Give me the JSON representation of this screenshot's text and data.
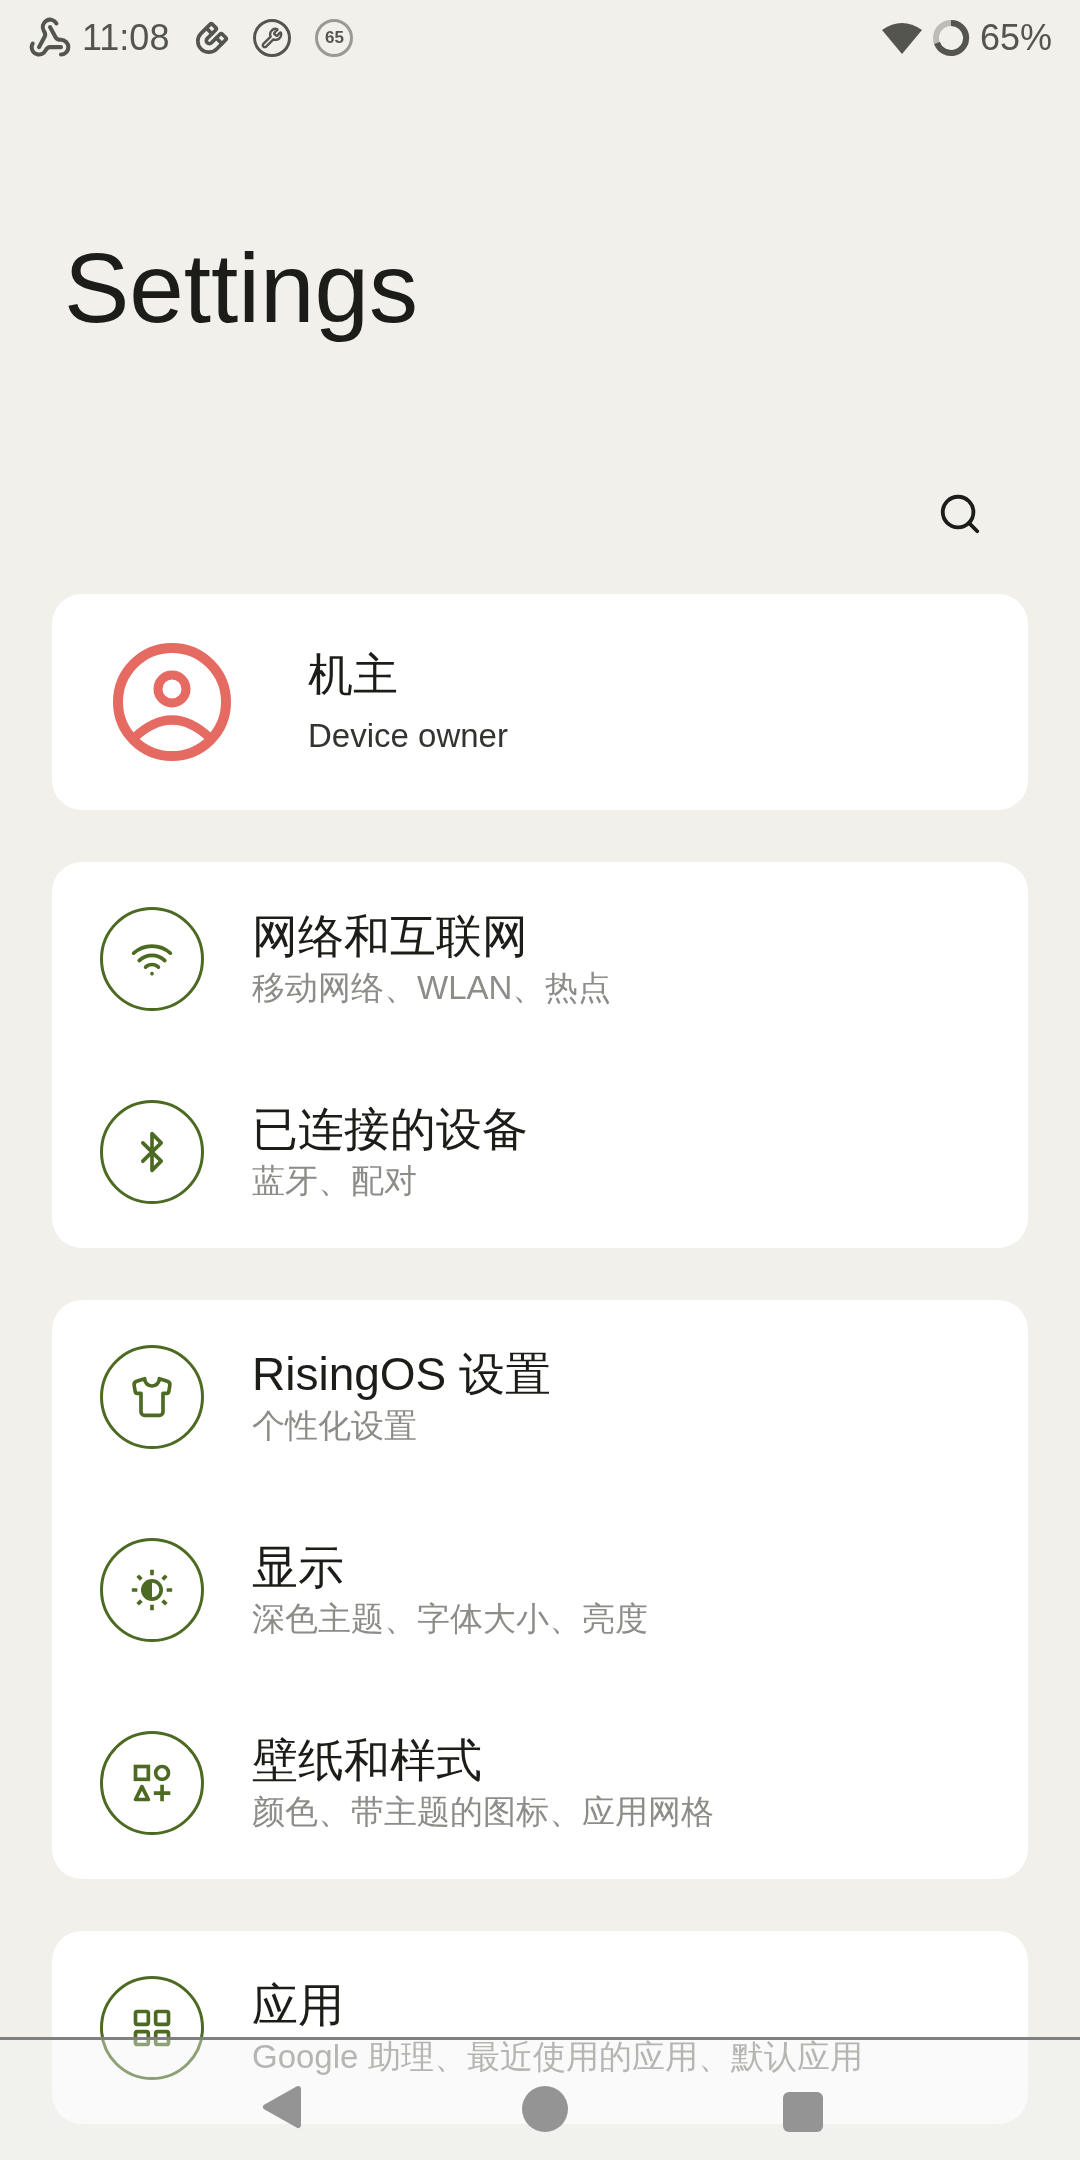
{
  "status_bar": {
    "time": "11:08",
    "badge_number": "65",
    "battery": "65%"
  },
  "title": "Settings",
  "owner": {
    "name": "机主",
    "subtitle": "Device owner"
  },
  "groups": [
    {
      "items": [
        {
          "title": "网络和互联网",
          "subtitle": "移动网络、WLAN、热点"
        },
        {
          "title": "已连接的设备",
          "subtitle": "蓝牙、配对"
        }
      ]
    },
    {
      "items": [
        {
          "title": "RisingOS 设置",
          "subtitle": "个性化设置"
        },
        {
          "title": "显示",
          "subtitle": "深色主题、字体大小、亮度"
        },
        {
          "title": "壁纸和样式",
          "subtitle": "颜色、带主题的图标、应用网格"
        }
      ]
    },
    {
      "items": [
        {
          "title": "应用",
          "subtitle": "Google 助理、最近使用的应用、默认应用"
        }
      ]
    }
  ]
}
